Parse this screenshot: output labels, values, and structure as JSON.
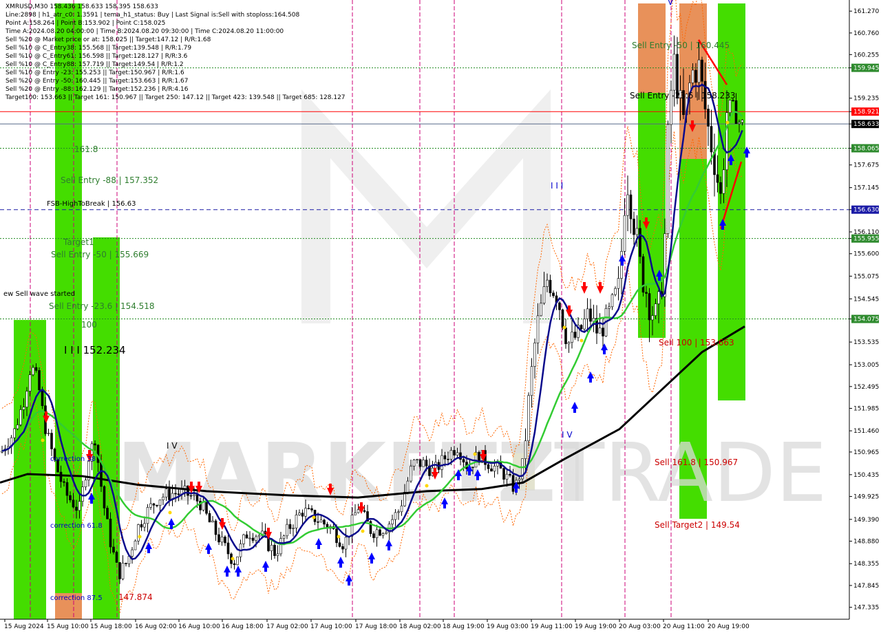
{
  "header": {
    "lines": [
      "XMRUSD,M30  158.436 158.633 158.395 158.633",
      "Line:2898 | h1_atr_c0: 1.3591 | tema_h1_status: Buy | Last Signal is:Sell with stoploss:164.508",
      "Point A:158.264 | Point B:153.902 | Point C:158.025",
      "Time A:2024.08.20 04:00:00 | Time B:2024.08.20 09:30:00 | Time C:2024.08.20 11:00:00",
      "Sell %20 @ Market price or at: 158.025 || Target:147.12 | R/R:1.68",
      "Sell %10 @ C_Entry38: 155.568 || Target:139.548 | R/R:1.79",
      "Sell %10 @ C_Entry61: 156.598 || Target:128.127 | R/R:3.6",
      "Sell %10 @ C_Entry88: 157.719 || Target:149.54 | R/R:1.2",
      "Sell %10 @ Entry -23: 155.253 || Target:150.967 | R/R:1.6",
      "Sell %20 @ Entry -50: 160.445 || Target:153.663 | R/R:1.67",
      "Sell %20 @ Entry -88: 162.129 || Target:152.236 | R/R:4.16",
      "Target100: 153.663 || Target 161: 150.967 || Target 250: 147.12 || Target 423: 139.548 || Target 685: 128.127"
    ]
  },
  "watermark": {
    "left": "MARKETZI",
    "right": "TRADE"
  },
  "colors": {
    "bull": "#000000",
    "bear": "#000000",
    "zone_green": "#44dd00",
    "zone_orange": "#e8915a",
    "ma_navy": "#0a0a8c",
    "ma_green": "#33cc33",
    "ma_black": "#000000",
    "level_red": "#ff0000",
    "level_blue": "#1a1aa6",
    "level_green": "#228b22",
    "sell_arrow": "#ff0000",
    "buy_arrow": "#0000ff",
    "vline": "#cc0077"
  },
  "chart_data": {
    "type": "candlestick",
    "symbol": "XMRUSD",
    "timeframe": "M30",
    "ylim": [
      147.12,
      161.45
    ],
    "y_ticks": [
      "161.270",
      "160.760",
      "160.255",
      "159.945",
      "159.235",
      "158.921",
      "158.633",
      "158.065",
      "157.675",
      "157.145",
      "156.630",
      "156.110",
      "155.955",
      "155.600",
      "155.075",
      "154.545",
      "154.075",
      "153.535",
      "153.005",
      "152.495",
      "151.985",
      "151.460",
      "150.965",
      "150.435",
      "149.925",
      "149.390",
      "148.880",
      "148.355",
      "147.845",
      "147.335"
    ],
    "y_tick_values": [
      161.27,
      160.76,
      160.255,
      159.945,
      159.235,
      158.921,
      158.633,
      158.065,
      157.675,
      157.145,
      156.63,
      156.11,
      155.955,
      155.6,
      155.075,
      154.545,
      154.075,
      153.535,
      153.005,
      152.495,
      151.985,
      151.46,
      150.965,
      150.435,
      149.925,
      149.39,
      148.88,
      148.355,
      147.845,
      147.335
    ],
    "highlight_ticks": [
      {
        "label": "159.945",
        "value": 159.945,
        "bg": "#2e8b2e"
      },
      {
        "label": "158.921",
        "value": 158.921,
        "bg": "#ff0000"
      },
      {
        "label": "158.633",
        "value": 158.633,
        "bg": "#000000"
      },
      {
        "label": "158.065",
        "value": 158.065,
        "bg": "#2e8b2e"
      },
      {
        "label": "156.630",
        "value": 156.63,
        "bg": "#1a1aa6"
      },
      {
        "label": "155.955",
        "value": 155.955,
        "bg": "#2e8b2e"
      },
      {
        "label": "154.075",
        "value": 154.075,
        "bg": "#2e8b2e"
      }
    ],
    "x_ticks": [
      "15 Aug 2024",
      "15 Aug 10:00",
      "15 Aug 18:00",
      "16 Aug 02:00",
      "16 Aug 10:00",
      "16 Aug 18:00",
      "17 Aug 02:00",
      "17 Aug 10:00",
      "17 Aug 18:00",
      "18 Aug 02:00",
      "18 Aug 19:00",
      "19 Aug 03:00",
      "19 Aug 11:00",
      "19 Aug 19:00",
      "20 Aug 03:00",
      "20 Aug 11:00",
      "20 Aug 19:00"
    ],
    "levels": [
      {
        "value": 159.945,
        "color": "#228b22",
        "style": "dotted"
      },
      {
        "value": 158.921,
        "color": "#ff0000",
        "style": "solid"
      },
      {
        "value": 158.633,
        "color": "#556688",
        "style": "solid"
      },
      {
        "value": 158.065,
        "color": "#228b22",
        "style": "dotted"
      },
      {
        "value": 156.63,
        "color": "#1a1aa6",
        "style": "dashed"
      },
      {
        "value": 155.955,
        "color": "#228b22",
        "style": "dotted"
      },
      {
        "value": 154.075,
        "color": "#228b22",
        "style": "dotted"
      }
    ],
    "annotations": [
      {
        "text": "Sell Entry -50 | 160.445",
        "color": "#2e7d2e",
        "value": 160.25
      },
      {
        "text": "Sell Entry -88 | 157.352",
        "color": "#2e7d2e",
        "value": 157.1
      },
      {
        "text": "161.8",
        "color": "#2e7d2e",
        "value": 157.85
      },
      {
        "text": "FSB-HighToBreak | 156.63",
        "color": "#000000",
        "value": 156.63
      },
      {
        "text": "Target1",
        "color": "#2e7d2e",
        "value": 155.85
      },
      {
        "text": "Sell Entry -50 | 155.669",
        "color": "#2e7d2e",
        "value": 155.55
      },
      {
        "text": "ew Sell wave started",
        "color": "#000000",
        "value": 154.7
      },
      {
        "text": "Sell Entry -23.6 | 154.518",
        "color": "#2e7d2e",
        "value": 154.4
      },
      {
        "text": "100",
        "color": "#2e7d2e",
        "value": 153.95
      },
      {
        "text": "I I I 152.234",
        "color": "#000000",
        "value": 153.4
      },
      {
        "text": "Sell Entry -23.6 | 158.233",
        "color": "#000000",
        "value": 159.2
      },
      {
        "text": "Sell 100 | 153.663",
        "color": "#cc0000",
        "value": 153.6
      },
      {
        "text": "Sell 161.8 | 150.967",
        "color": "#cc0000",
        "value": 150.9
      },
      {
        "text": "Sell Target2 | 149.54",
        "color": "#cc0000",
        "value": 149.35
      },
      {
        "text": "correction 38",
        "color": "#0000cc",
        "value": 150.95
      },
      {
        "text": "correction 61.8",
        "color": "#0000cc",
        "value": 149.35
      },
      {
        "text": "correction 87.5",
        "color": "#0000cc",
        "value": 147.8
      },
      {
        "text": "147.874",
        "color": "#cc0000",
        "value": 147.8
      },
      {
        "text": "I V",
        "color": "#000000",
        "value": 151.2
      },
      {
        "text": "I I I",
        "color": "#0000cc",
        "value": 157.05
      },
      {
        "text": "I V",
        "color": "#0000cc",
        "value": 151.45
      },
      {
        "text": "V",
        "color": "#0000cc",
        "value": 161.4
      }
    ],
    "close": 158.633
  }
}
